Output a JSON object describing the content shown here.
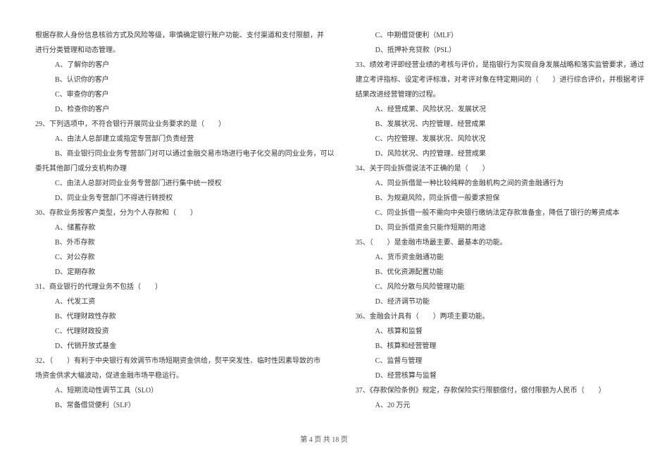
{
  "left": {
    "intro_line1": "根据存款人身份信息核验方式及风险等级，审慎确定银行账户功能、支付渠道和支付限额，并",
    "intro_line2": "进行分类管理和动态管理。",
    "q28": {
      "a": "A、了解你的客户",
      "b": "B、认识你的客户",
      "c": "C、审查你的客户",
      "d": "D、检查你的客户"
    },
    "q29": {
      "stem": "29、下列选项中，不符合银行开展同业业务要求的是（　　）",
      "a": "A、由法人总部建立或指定专营部门负责经营",
      "b_line1": "B、商业银行同业业务专营部门对可以通过金融交易市场进行电子化交易的同业业务，可以",
      "b_line2": "委托其他部门或分支机构办理",
      "c": "C、由法人总部对同业业务专营部门进行集中统一授权",
      "d": "D、同业业务专营部门不得进行转授权"
    },
    "q30": {
      "stem": "30、存款业务按客户类型，分为个人存款和（　　）",
      "a": "A、储蓄存款",
      "b": "B、外币存款",
      "c": "C、对公存款",
      "d": "D、定期存款"
    },
    "q31": {
      "stem": "31、商业银行的代理业务不包括（　　）",
      "a": "A、代发工资",
      "b": "B、代理财政性存款",
      "c": "C、代理财政投资",
      "d": "D、代销开放式基金"
    },
    "q32": {
      "stem_line1": "32、（　　）有利于中央银行有效调节市场短期资金供给，熨平突发性、临时性因素导致的市",
      "stem_line2": "场资金供求大幅波动，促进金融市场平稳运行。",
      "a": "A、短期流动性调节工具（SLO）",
      "b": "B、常备借贷便利（SLF）"
    }
  },
  "right": {
    "q32": {
      "c": "C、中期借贷便利（MLF）",
      "d": "D、抵押补充贷款（PSL）"
    },
    "q33": {
      "stem_line1": "33、绩效考评即经营业绩的考核与评价，是指银行为实现自身发展战略和落实监管要求，通过",
      "stem_line2": "建立考评指标、设定考评标准，对考评对象在特定期间的（　　）进行综合评价，并根据考评",
      "stem_line3": "结果改进经营管理的过程。",
      "a": "A、经营成果、风险状况、发展状况",
      "b": "B、发展状况、内控管理、经营成果",
      "c": "C、内控管理、发展状况、风险状况",
      "d": "D、风险状况、内控管理、经营成果"
    },
    "q34": {
      "stem": "34、关于同业拆借说法不正确的是（　　）",
      "a": "A、同业拆借是一种比较纯粹的金融机构之间的资金融通行为",
      "b": "B、为规避风险，同业拆借一般要求担保",
      "c": "C、同业拆借一般不需向中央银行缴纳法定存款准备金，降低了银行的筹资成本",
      "d": "D、同业拆借资金只能作短期的用途"
    },
    "q35": {
      "stem": "35、（　　）是金融市场最主要、最基本的功能。",
      "a": "A、货币资金融通功能",
      "b": "B、优化资源配置功能",
      "c": "C、风险分散与风险管理功能",
      "d": "D、经济调节功能"
    },
    "q36": {
      "stem": "36、金融会计具有（　　）两项主要功能。",
      "a": "A、核算和监督",
      "b": "B、核算和经营管理",
      "c": "C、监督与管理",
      "d": "D、经营核算与监督"
    },
    "q37": {
      "stem": "37、《存款保险条例》规定，存款保险实行限额偿付，偿付限额为人民币（　　）",
      "a": "A、20 万元"
    }
  },
  "footer": "第 4 页 共 18 页"
}
